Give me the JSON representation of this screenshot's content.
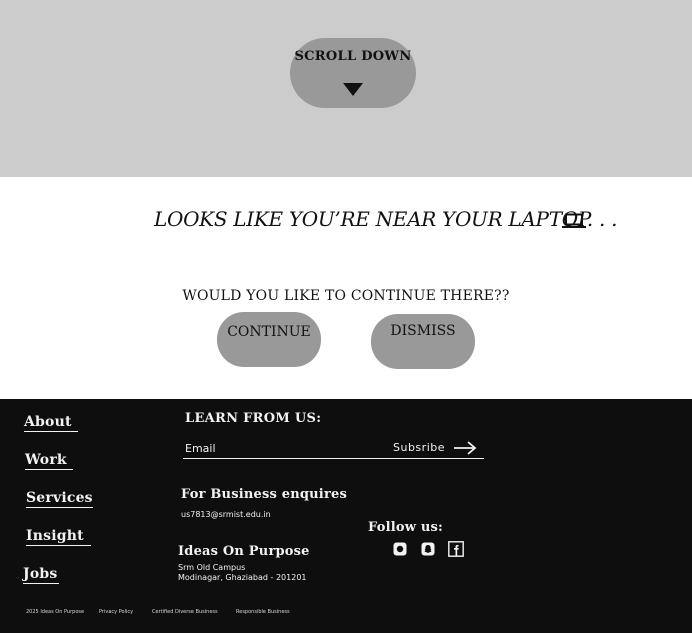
{
  "scroll": {
    "label": "SCROLL DOWN"
  },
  "prompt": {
    "headline": "LOOKS LIKE YOU’RE NEAR YOUR LAPTOP. . .",
    "question": "WOULD YOU LIKE TO CONTINUE THERE??",
    "continue_label": "CONTINUE",
    "dismiss_label": "DISMISS"
  },
  "footer": {
    "nav": [
      "About",
      "Work",
      "Services",
      "Insight",
      "Jobs"
    ],
    "learn_title": "LEARN FROM US:",
    "email_placeholder": "Email",
    "subscribe_label": "Subsribe",
    "business_title": "For Business enquires",
    "business_email": "us7813@srmist.edu.in",
    "follow_title": "Follow us:",
    "social_icons": [
      "instagram-icon",
      "snapchat-icon",
      "facebook-icon"
    ],
    "company_name": "Ideas On Purpose",
    "address_line1": "Srm Old Campus",
    "address_line2": "Modinagar, Ghaziabad - 201201",
    "bottom_links": [
      "2025 Ideas On Purpose",
      "Privacy Policy",
      "Certified Diverse Business",
      "Responsible Business"
    ]
  },
  "colors": {
    "top_band": "#cccccc",
    "pill": "#999999",
    "footer_bg": "#0e0e0e",
    "footer_text": "#f2f2f2"
  }
}
